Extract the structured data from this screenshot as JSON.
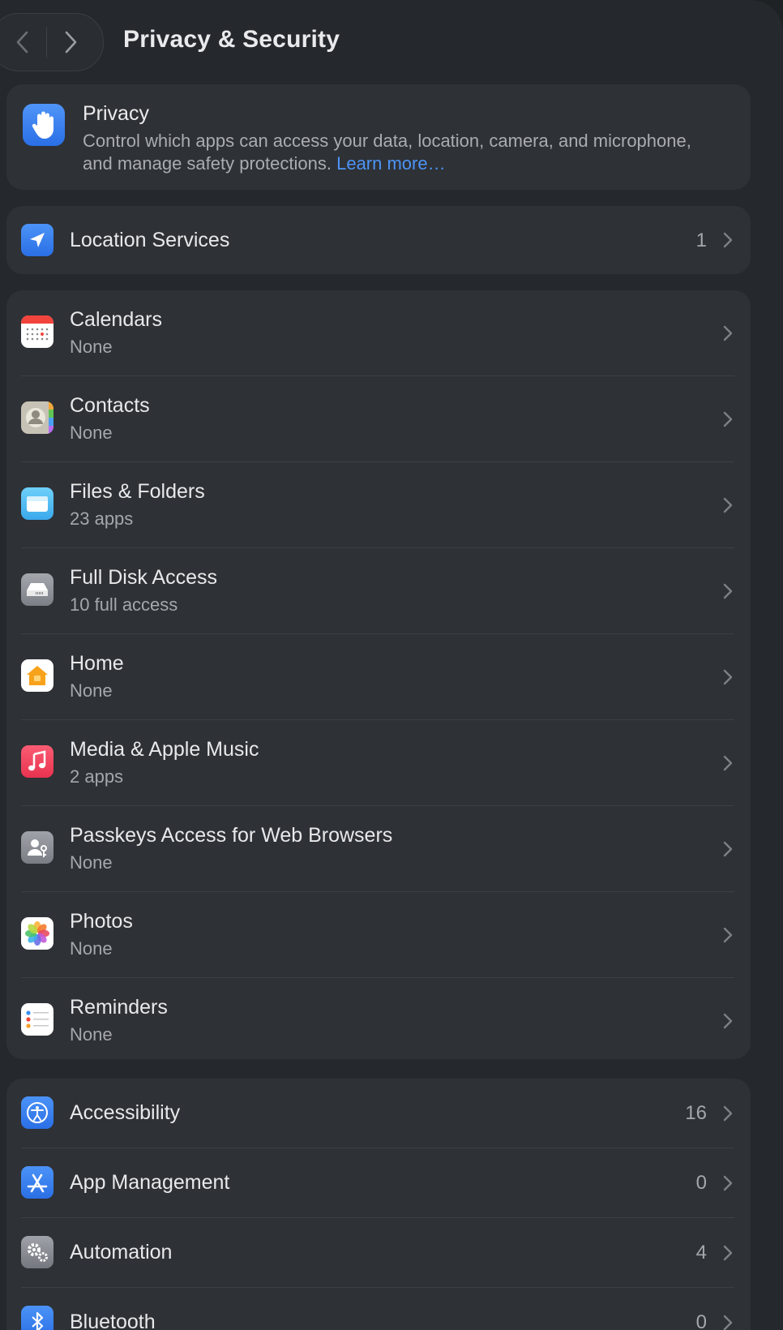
{
  "header": {
    "title": "Privacy & Security"
  },
  "privacy": {
    "title": "Privacy",
    "description": "Control which apps can access your data, location, camera, and microphone, and manage safety protections.",
    "learn_more": "Learn more…"
  },
  "location": {
    "label": "Location Services",
    "count": "1"
  },
  "permissions": [
    {
      "label": "Calendars",
      "sub": "None",
      "icon": "calendar-icon"
    },
    {
      "label": "Contacts",
      "sub": "None",
      "icon": "contacts-icon"
    },
    {
      "label": "Files & Folders",
      "sub": "23 apps",
      "icon": "folder-icon"
    },
    {
      "label": "Full Disk Access",
      "sub": "10 full access",
      "icon": "disk-icon"
    },
    {
      "label": "Home",
      "sub": "None",
      "icon": "home-icon"
    },
    {
      "label": "Media & Apple Music",
      "sub": "2 apps",
      "icon": "music-icon"
    },
    {
      "label": "Passkeys Access for Web Browsers",
      "sub": "None",
      "icon": "passkey-icon"
    },
    {
      "label": "Photos",
      "sub": "None",
      "icon": "photos-icon"
    },
    {
      "label": "Reminders",
      "sub": "None",
      "icon": "reminders-icon"
    }
  ],
  "system": [
    {
      "label": "Accessibility",
      "count": "16",
      "icon": "accessibility-icon"
    },
    {
      "label": "App Management",
      "count": "0",
      "icon": "app-store-icon"
    },
    {
      "label": "Automation",
      "count": "4",
      "icon": "gears-icon"
    },
    {
      "label": "Bluetooth",
      "count": "0",
      "icon": "bluetooth-icon"
    }
  ],
  "colors": {
    "background": "#25282c",
    "card": "#2e3135",
    "accent_link": "#4c94f7",
    "primary_text": "#e8e9eb",
    "secondary_text": "#a4a7ab"
  }
}
